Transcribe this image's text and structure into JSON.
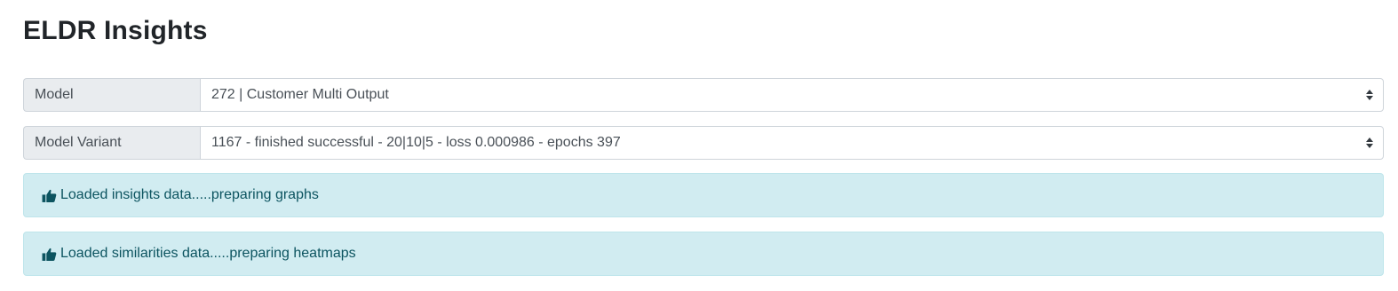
{
  "page": {
    "title": "ELDR Insights"
  },
  "model": {
    "label": "Model",
    "selected": "272 | Customer Multi Output"
  },
  "model_variant": {
    "label": "Model Variant",
    "selected": "1167 - finished successful - 20|10|5 - loss 0.000986 - epochs 397"
  },
  "alerts": [
    {
      "icon": "thumbs-up-icon",
      "text": "Loaded insights data.....preparing graphs"
    },
    {
      "icon": "thumbs-up-icon",
      "text": "Loaded similarities data.....preparing heatmaps"
    }
  ],
  "colors": {
    "alert_bg": "#d1ecf1",
    "alert_border": "#bee5eb",
    "alert_text": "#0c5460",
    "label_bg": "#e9ecef",
    "input_border": "#ced4da"
  }
}
